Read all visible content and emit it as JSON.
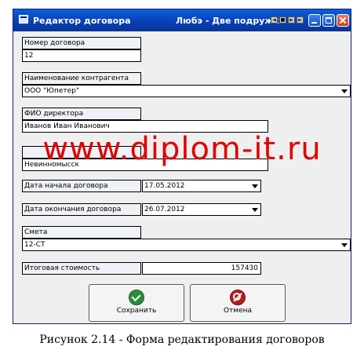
{
  "window": {
    "title": "Редактор договора",
    "right_title": "Любэ - Две подружки",
    "player_controls": [
      "◄",
      "■",
      "►",
      "►"
    ]
  },
  "form": {
    "contract_number": {
      "label": "Номер договора",
      "value": "12"
    },
    "contractor": {
      "label": "Наименование контрагента",
      "value": "ООО \"Юпетер\""
    },
    "director": {
      "label": "ФИО директора",
      "value": "Иванов Иван Иванович"
    },
    "city": {
      "value": "Невинномысск"
    },
    "start_date": {
      "label": "Дата начала договора",
      "value": "17.05.2012"
    },
    "end_date": {
      "label": "Дата окончания договора",
      "value": "26.07.2012"
    },
    "estimate": {
      "label": "Смета",
      "value": "12-СТ"
    },
    "total": {
      "label": "Итоговая стоимость",
      "value": "157430"
    }
  },
  "buttons": {
    "save_label": "Сохранить",
    "cancel_label": "Отмена"
  },
  "watermark": "www.diplom-it.ru",
  "caption": "Рисунок 2.14 - Форма редактирования договоров",
  "icons": {
    "save": "check-circle-icon",
    "cancel": "no-entry-icon",
    "colors": {
      "save": "#2e8b3c",
      "cancel": "#b71c1c",
      "watermark": "#e00000"
    }
  }
}
